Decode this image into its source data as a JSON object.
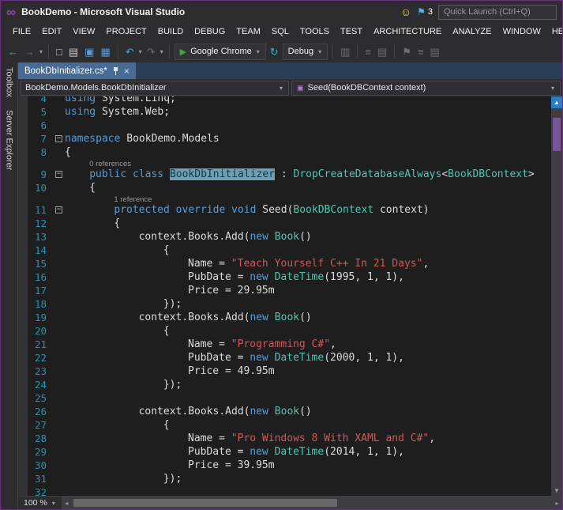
{
  "window": {
    "title": "BookDemo - Microsoft Visual Studio",
    "quick_launch": "Quick Launch (Ctrl+Q)",
    "notification_count": "3"
  },
  "menu": {
    "items": [
      "FILE",
      "EDIT",
      "VIEW",
      "PROJECT",
      "BUILD",
      "DEBUG",
      "TEAM",
      "SQL",
      "TOOLS",
      "TEST",
      "ARCHITECTURE",
      "ANALYZE",
      "WINDOW",
      "HELP"
    ]
  },
  "toolbar": {
    "browser": "Google Chrome",
    "config": "Debug"
  },
  "side_tabs": [
    "Toolbox",
    "Server Explorer"
  ],
  "tab": {
    "title": "BookDbInitializer.cs*"
  },
  "navbar": {
    "type_dropdown": "BookDemo.Models.BookDbInitializer",
    "member_dropdown": "Seed(BookDBContext context)"
  },
  "statusbar": {
    "zoom": "100 %"
  },
  "icons": {
    "logo": "∞",
    "smiley": "☺",
    "flag": "⚑",
    "back": "←",
    "forward": "→",
    "dropdown": "▾",
    "new_file": "□",
    "open": "▤",
    "save": "▣",
    "save_all": "▦",
    "undo": "↶",
    "redo": "↷",
    "run": "▶",
    "refresh": "↻",
    "attach": "▥",
    "misc_lines": "≡",
    "misc_grid": "▤",
    "misc_flag": "⚑",
    "close": "×",
    "minus": "−",
    "up": "▲",
    "down": "▼",
    "left": "◂",
    "right": "▸"
  },
  "theme": {
    "chrome-bg": "#2d2d30",
    "editor-bg": "#1e1e1e",
    "gutter-bg": "#333337",
    "tabwell-bg": "#2a3e57",
    "tab-active-bg": "#456b96",
    "keyword": "#569cd6",
    "type": "#4ec9b0",
    "string": "#cd5a5a",
    "plain": "#dcdcdc",
    "line-number": "#2b91af",
    "codelens": "#9a9a9a",
    "highlight-bg": "#6f9fb4",
    "highlight-fg": "#0f3a46",
    "logo-purple": "#8a4ab0",
    "run-green": "#3fa93c",
    "icon-teal": "#3bb0d0",
    "icon-gray": "#6e6e6e",
    "scroll-track": "#3e3e42",
    "scroll-thumb": "#7a559c",
    "scroll-btn-blue": "#2d7dc2",
    "smiley-yellow": "#f2cf4a",
    "flag-blue": "#57b0e8",
    "border-purple": "#6b2f7e"
  },
  "editor": {
    "code": {
      "lines": [
        {
          "n": 4,
          "i": 0,
          "s": [
            [
              "k",
              "using"
            ],
            [
              "p",
              " System.Linq;"
            ]
          ]
        },
        {
          "n": 5,
          "i": 0,
          "s": [
            [
              "k",
              "using"
            ],
            [
              "p",
              " System.Web;"
            ]
          ]
        },
        {
          "n": 6,
          "i": 0,
          "s": []
        },
        {
          "n": 7,
          "i": 0,
          "f": true,
          "s": [
            [
              "k",
              "namespace"
            ],
            [
              "p",
              " BookDemo.Models"
            ]
          ]
        },
        {
          "n": 8,
          "i": 0,
          "s": [
            [
              "p",
              "{"
            ]
          ]
        },
        {
          "n": 9,
          "i": 4,
          "f": true,
          "cl": "0 references",
          "s": [
            [
              "k",
              "public"
            ],
            [
              "p",
              " "
            ],
            [
              "k",
              "class"
            ],
            [
              "p",
              " "
            ],
            [
              "h",
              "BookDbInitializer"
            ],
            [
              "p",
              " : "
            ],
            [
              "t",
              "DropCreateDatabaseAlways"
            ],
            [
              "p",
              "<"
            ],
            [
              "t",
              "BookDBContext"
            ],
            [
              "p",
              ">"
            ]
          ]
        },
        {
          "n": 10,
          "i": 4,
          "s": [
            [
              "p",
              "{"
            ]
          ]
        },
        {
          "n": 11,
          "i": 8,
          "f": true,
          "cl": "1 reference",
          "s": [
            [
              "k",
              "protected"
            ],
            [
              "p",
              " "
            ],
            [
              "k",
              "override"
            ],
            [
              "p",
              " "
            ],
            [
              "k",
              "void"
            ],
            [
              "p",
              " Seed("
            ],
            [
              "t",
              "BookDBContext"
            ],
            [
              "p",
              " context)"
            ]
          ]
        },
        {
          "n": 12,
          "i": 8,
          "s": [
            [
              "p",
              "{"
            ]
          ]
        },
        {
          "n": 13,
          "i": 12,
          "s": [
            [
              "p",
              "context.Books.Add("
            ],
            [
              "k",
              "new"
            ],
            [
              "p",
              " "
            ],
            [
              "t",
              "Book"
            ],
            [
              "p",
              "()"
            ]
          ]
        },
        {
          "n": 14,
          "i": 16,
          "s": [
            [
              "p",
              "{"
            ]
          ]
        },
        {
          "n": 15,
          "i": 20,
          "s": [
            [
              "p",
              "Name = "
            ],
            [
              "s",
              "\"Teach Yourself C++ In 21 Days\""
            ],
            [
              "p",
              ","
            ]
          ]
        },
        {
          "n": 16,
          "i": 20,
          "s": [
            [
              "p",
              "PubDate = "
            ],
            [
              "k",
              "new"
            ],
            [
              "p",
              " "
            ],
            [
              "t",
              "DateTime"
            ],
            [
              "p",
              "(1995, 1, 1),"
            ]
          ]
        },
        {
          "n": 17,
          "i": 20,
          "s": [
            [
              "p",
              "Price = 29.95m"
            ]
          ]
        },
        {
          "n": 18,
          "i": 16,
          "s": [
            [
              "p",
              "});"
            ]
          ]
        },
        {
          "n": 19,
          "i": 12,
          "s": [
            [
              "p",
              "context.Books.Add("
            ],
            [
              "k",
              "new"
            ],
            [
              "p",
              " "
            ],
            [
              "t",
              "Book"
            ],
            [
              "p",
              "()"
            ]
          ]
        },
        {
          "n": 20,
          "i": 16,
          "s": [
            [
              "p",
              "{"
            ]
          ]
        },
        {
          "n": 21,
          "i": 20,
          "s": [
            [
              "p",
              "Name = "
            ],
            [
              "s",
              "\"Programming C#\""
            ],
            [
              "p",
              ","
            ]
          ]
        },
        {
          "n": 22,
          "i": 20,
          "s": [
            [
              "p",
              "PubDate = "
            ],
            [
              "k",
              "new"
            ],
            [
              "p",
              " "
            ],
            [
              "t",
              "DateTime"
            ],
            [
              "p",
              "(2000, 1, 1),"
            ]
          ]
        },
        {
          "n": 23,
          "i": 20,
          "s": [
            [
              "p",
              "Price = 49.95m"
            ]
          ]
        },
        {
          "n": 24,
          "i": 16,
          "s": [
            [
              "p",
              "});"
            ]
          ]
        },
        {
          "n": 25,
          "i": 0,
          "s": []
        },
        {
          "n": 26,
          "i": 12,
          "s": [
            [
              "p",
              "context.Books.Add("
            ],
            [
              "k",
              "new"
            ],
            [
              "p",
              " "
            ],
            [
              "t",
              "Book"
            ],
            [
              "p",
              "()"
            ]
          ]
        },
        {
          "n": 27,
          "i": 16,
          "s": [
            [
              "p",
              "{"
            ]
          ]
        },
        {
          "n": 28,
          "i": 20,
          "s": [
            [
              "p",
              "Name = "
            ],
            [
              "s",
              "\"Pro Windows 8 With XAML and C#\""
            ],
            [
              "p",
              ","
            ]
          ]
        },
        {
          "n": 29,
          "i": 20,
          "s": [
            [
              "p",
              "PubDate = "
            ],
            [
              "k",
              "new"
            ],
            [
              "p",
              " "
            ],
            [
              "t",
              "DateTime"
            ],
            [
              "p",
              "(2014, 1, 1),"
            ]
          ]
        },
        {
          "n": 30,
          "i": 20,
          "s": [
            [
              "p",
              "Price = 39.95m"
            ]
          ]
        },
        {
          "n": 31,
          "i": 16,
          "s": [
            [
              "p",
              "});"
            ]
          ]
        },
        {
          "n": 32,
          "i": 0,
          "s": []
        }
      ]
    }
  }
}
